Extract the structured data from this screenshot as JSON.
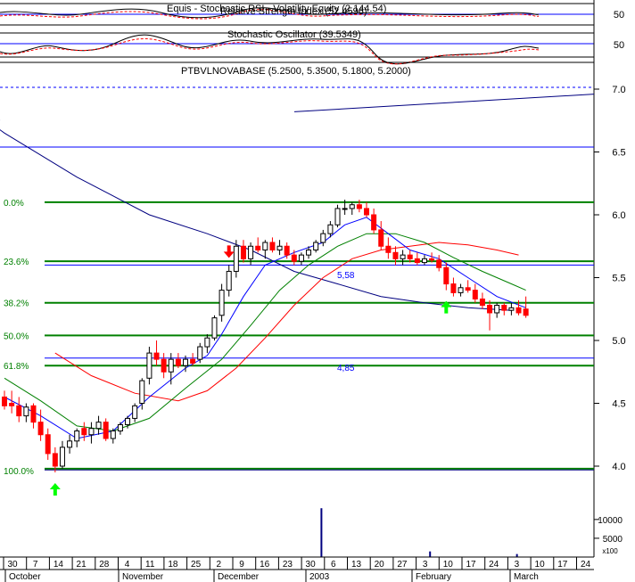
{
  "indicator_titles": [
    "Equis - Stochastic RSI - Volatility Equity (2,144.54)",
    "Relative Strength Index (52.4596)",
    "Stochastic Oscillator (39.5349)"
  ],
  "price_title": "PTBVLNOVABASE (5.2500, 5.3500, 5.1800, 5.2000)",
  "colors": {
    "up": "#000000",
    "down": "#ff0000",
    "fib": "#008000",
    "ma_fast": "#0000ff",
    "ma_mid": "#008000",
    "ma_slow": "#ff0000",
    "long_ma": "#000080",
    "arrow_up": "#00ff00",
    "arrow_down": "#ff0000",
    "volume": "#000080"
  },
  "chart_data": {
    "type": "candlestick",
    "price_axis": {
      "min": 3.8,
      "max": 7.1,
      "ticks": [
        4.0,
        4.5,
        5.0,
        5.5,
        6.0,
        6.5,
        7.0
      ]
    },
    "volume_axis": {
      "ticks": [
        5000,
        10000
      ],
      "multiplier_label": "x100"
    },
    "indicator_ticks": [
      "50",
      "50"
    ],
    "x_ticks": [
      "30",
      "7",
      "14",
      "21",
      "28",
      "4",
      "11",
      "18",
      "25",
      "2",
      "9",
      "16",
      "23",
      "30",
      "6",
      "13",
      "20",
      "27",
      "3",
      "10",
      "17",
      "24",
      "3",
      "10",
      "17",
      "24"
    ],
    "month_labels": [
      "October",
      "November",
      "December",
      "2003",
      "February",
      "March"
    ],
    "fibonacci": [
      {
        "label": "0.0%",
        "price": 6.1
      },
      {
        "label": "23.6%",
        "price": 5.63
      },
      {
        "label": "38.2%",
        "price": 5.3
      },
      {
        "label": "50.0%",
        "price": 5.04
      },
      {
        "label": "61.8%",
        "price": 4.8
      },
      {
        "label": "100.0%",
        "price": 3.98
      }
    ],
    "annotations": [
      {
        "text": "5,58",
        "price": 5.58
      },
      {
        "text": "4,85",
        "price": 4.85
      }
    ],
    "candles": [
      [
        4.55,
        4.6,
        4.45,
        4.48
      ],
      [
        4.5,
        4.6,
        4.42,
        4.48
      ],
      [
        4.48,
        4.55,
        4.35,
        4.4
      ],
      [
        4.4,
        4.5,
        4.35,
        4.47
      ],
      [
        4.48,
        4.5,
        4.3,
        4.35
      ],
      [
        4.35,
        4.45,
        4.2,
        4.25
      ],
      [
        4.25,
        4.3,
        4.05,
        4.1
      ],
      [
        4.1,
        4.15,
        3.95,
        4.0
      ],
      [
        4.0,
        4.2,
        3.98,
        4.15
      ],
      [
        4.15,
        4.25,
        4.1,
        4.2
      ],
      [
        4.2,
        4.3,
        4.15,
        4.28
      ],
      [
        4.3,
        4.35,
        4.2,
        4.25
      ],
      [
        4.25,
        4.35,
        4.18,
        4.3
      ],
      [
        4.3,
        4.4,
        4.25,
        4.35
      ],
      [
        4.35,
        4.38,
        4.2,
        4.22
      ],
      [
        4.22,
        4.3,
        4.18,
        4.28
      ],
      [
        4.28,
        4.35,
        4.25,
        4.33
      ],
      [
        4.33,
        4.4,
        4.3,
        4.38
      ],
      [
        4.38,
        4.5,
        4.35,
        4.48
      ],
      [
        4.5,
        4.7,
        4.45,
        4.68
      ],
      [
        4.7,
        4.95,
        4.65,
        4.9
      ],
      [
        4.9,
        5.0,
        4.8,
        4.85
      ],
      [
        4.85,
        4.9,
        4.7,
        4.75
      ],
      [
        4.75,
        4.9,
        4.65,
        4.85
      ],
      [
        4.85,
        4.9,
        4.78,
        4.8
      ],
      [
        4.8,
        4.88,
        4.75,
        4.85
      ],
      [
        4.85,
        4.9,
        4.8,
        4.82
      ],
      [
        4.85,
        4.98,
        4.82,
        4.95
      ],
      [
        4.95,
        5.05,
        4.9,
        5.02
      ],
      [
        5.02,
        5.2,
        5.0,
        5.18
      ],
      [
        5.2,
        5.45,
        5.15,
        5.4
      ],
      [
        5.4,
        5.6,
        5.35,
        5.55
      ],
      [
        5.55,
        5.8,
        5.5,
        5.75
      ],
      [
        5.75,
        5.8,
        5.62,
        5.65
      ],
      [
        5.65,
        5.78,
        5.6,
        5.75
      ],
      [
        5.75,
        5.82,
        5.7,
        5.72
      ],
      [
        5.72,
        5.8,
        5.65,
        5.78
      ],
      [
        5.78,
        5.82,
        5.7,
        5.72
      ],
      [
        5.72,
        5.8,
        5.68,
        5.75
      ],
      [
        5.75,
        5.78,
        5.65,
        5.68
      ],
      [
        5.68,
        5.72,
        5.6,
        5.63
      ],
      [
        5.63,
        5.7,
        5.6,
        5.68
      ],
      [
        5.68,
        5.75,
        5.65,
        5.72
      ],
      [
        5.72,
        5.8,
        5.7,
        5.78
      ],
      [
        5.78,
        5.88,
        5.75,
        5.85
      ],
      [
        5.85,
        5.95,
        5.82,
        5.92
      ],
      [
        5.92,
        6.08,
        5.9,
        6.05
      ],
      [
        6.05,
        6.12,
        6.0,
        6.05
      ],
      [
        6.05,
        6.1,
        6.0,
        6.08
      ],
      [
        6.08,
        6.12,
        6.02,
        6.05
      ],
      [
        6.05,
        6.1,
        5.98,
        6.0
      ],
      [
        6.0,
        6.05,
        5.85,
        5.88
      ],
      [
        5.88,
        5.95,
        5.72,
        5.75
      ],
      [
        5.75,
        5.82,
        5.65,
        5.7
      ],
      [
        5.7,
        5.75,
        5.6,
        5.65
      ],
      [
        5.65,
        5.72,
        5.6,
        5.68
      ],
      [
        5.68,
        5.72,
        5.62,
        5.65
      ],
      [
        5.65,
        5.7,
        5.6,
        5.62
      ],
      [
        5.62,
        5.68,
        5.6,
        5.65
      ],
      [
        5.65,
        5.7,
        5.62,
        5.64
      ],
      [
        5.64,
        5.68,
        5.55,
        5.58
      ],
      [
        5.58,
        5.62,
        5.4,
        5.45
      ],
      [
        5.45,
        5.5,
        5.35,
        5.38
      ],
      [
        5.38,
        5.45,
        5.35,
        5.42
      ],
      [
        5.42,
        5.48,
        5.38,
        5.4
      ],
      [
        5.4,
        5.45,
        5.3,
        5.33
      ],
      [
        5.33,
        5.38,
        5.25,
        5.28
      ],
      [
        5.28,
        5.32,
        5.08,
        5.22
      ],
      [
        5.22,
        5.3,
        5.18,
        5.28
      ],
      [
        5.28,
        5.3,
        5.2,
        5.24
      ],
      [
        5.24,
        5.3,
        5.2,
        5.26
      ],
      [
        5.26,
        5.32,
        5.2,
        5.22
      ],
      [
        5.25,
        5.35,
        5.18,
        5.2
      ]
    ],
    "ma_fast": [
      [
        0,
        4.55
      ],
      [
        5,
        4.4
      ],
      [
        10,
        4.22
      ],
      [
        15,
        4.28
      ],
      [
        20,
        4.55
      ],
      [
        25,
        4.78
      ],
      [
        28,
        4.88
      ],
      [
        30,
        5.05
      ],
      [
        33,
        5.35
      ],
      [
        36,
        5.6
      ],
      [
        40,
        5.7
      ],
      [
        44,
        5.78
      ],
      [
        47,
        5.92
      ],
      [
        50,
        5.98
      ],
      [
        53,
        5.85
      ],
      [
        56,
        5.72
      ],
      [
        60,
        5.65
      ],
      [
        64,
        5.5
      ],
      [
        68,
        5.35
      ],
      [
        72,
        5.26
      ]
    ],
    "ma_mid": [
      [
        0,
        4.7
      ],
      [
        5,
        4.52
      ],
      [
        10,
        4.32
      ],
      [
        15,
        4.28
      ],
      [
        20,
        4.38
      ],
      [
        25,
        4.62
      ],
      [
        30,
        4.85
      ],
      [
        34,
        5.12
      ],
      [
        38,
        5.4
      ],
      [
        42,
        5.6
      ],
      [
        46,
        5.75
      ],
      [
        50,
        5.85
      ],
      [
        54,
        5.85
      ],
      [
        58,
        5.78
      ],
      [
        62,
        5.66
      ],
      [
        66,
        5.55
      ],
      [
        70,
        5.45
      ],
      [
        72,
        5.4
      ]
    ],
    "ma_slow": [
      [
        7,
        4.9
      ],
      [
        12,
        4.72
      ],
      [
        18,
        4.58
      ],
      [
        24,
        4.52
      ],
      [
        28,
        4.6
      ],
      [
        32,
        4.78
      ],
      [
        36,
        5.02
      ],
      [
        40,
        5.28
      ],
      [
        44,
        5.5
      ],
      [
        48,
        5.65
      ],
      [
        52,
        5.72
      ],
      [
        56,
        5.75
      ],
      [
        60,
        5.78
      ],
      [
        64,
        5.76
      ],
      [
        68,
        5.72
      ],
      [
        71,
        5.68
      ]
    ],
    "long_ma": [
      [
        -6,
        6.9
      ],
      [
        0,
        6.65
      ],
      [
        10,
        6.3
      ],
      [
        20,
        6.0
      ],
      [
        28,
        5.85
      ],
      [
        34,
        5.72
      ],
      [
        40,
        5.55
      ],
      [
        46,
        5.45
      ],
      [
        52,
        5.35
      ],
      [
        58,
        5.3
      ],
      [
        64,
        5.26
      ],
      [
        70,
        5.24
      ]
    ],
    "arrows": [
      {
        "type": "up",
        "index": 7
      },
      {
        "type": "down",
        "index": 31
      },
      {
        "type": "up",
        "index": 61
      }
    ],
    "volume_spikes": [
      {
        "index": 45,
        "value": 13000
      },
      {
        "index": 60,
        "value": 1500
      },
      {
        "index": 72,
        "value": 800
      }
    ]
  }
}
